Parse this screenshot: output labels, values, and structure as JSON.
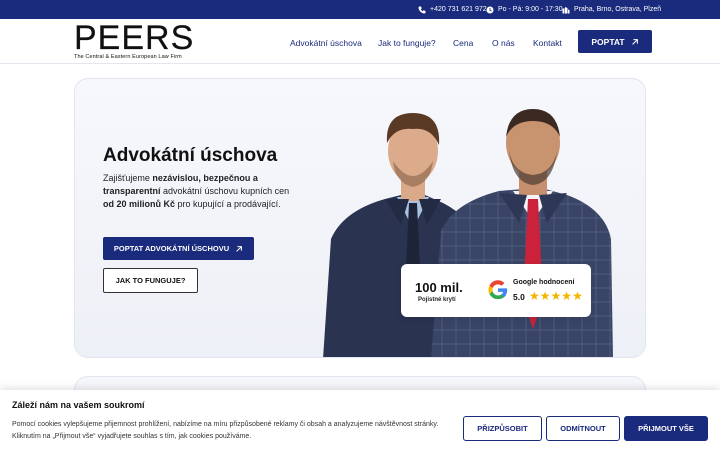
{
  "topbar": {
    "phone": "+420 731 621 972",
    "hours": "Po - Pá: 9:00 - 17:30",
    "locations": "Praha, Brno, Ostrava, Plzeň"
  },
  "header": {
    "logo_word": "PEERS",
    "logo_sub": "The Central & Eastern European Law Firm",
    "nav": [
      "Advokátní úschova",
      "Jak to funguje?",
      "Cena",
      "O nás",
      "Kontakt"
    ],
    "cta": "POPTAT"
  },
  "hero": {
    "title": "Advokátní úschova",
    "text_1": "Zajišťujeme ",
    "text_b1": "nezávislou, bezpečnou a transparentní",
    "text_2": " advokátní úschovu kupních cen ",
    "text_b2": "od 20 milionů Kč",
    "text_3": " pro kupující a prodávající.",
    "primary_button": "POPTAT ADVOKÁTNÍ ÚSCHOVU",
    "secondary_button": "JAK TO FUNGUJE?"
  },
  "rating": {
    "value": "100 mil.",
    "caption": "Pojistné krytí",
    "google_title": "Google hodnocení",
    "google_score": "5.0",
    "stars": 5
  },
  "cookie": {
    "title": "Záleží nám na vašem soukromí",
    "text": "Pomocí cookies vylepšujeme přijemnost prohlížení, nabízíme na míru přizpůsobené reklamy či obsah a analyzujeme návštěvnost stránky. Kliknutím na „Přijmout vše“ vyjadřujete souhlas s tím, jak cookies používáme.",
    "customize": "PŘIZPŮSOBIT",
    "reject": "ODMÍTNOUT",
    "accept": "PŘIJMOUT VŠE"
  },
  "colors": {
    "brand": "#1a2a7c",
    "star": "#f5b400"
  },
  "icons": {
    "phone": "phone-icon",
    "clock": "clock-icon",
    "location": "buildings-icon",
    "arrow": "arrow-up-right-icon",
    "google": "google-g-icon",
    "star": "star-icon"
  }
}
